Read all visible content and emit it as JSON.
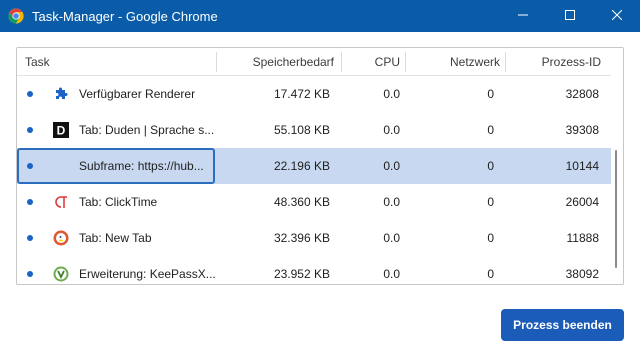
{
  "window": {
    "title": "Task-Manager - Google Chrome",
    "controls": [
      "minimize-icon",
      "maximize-icon",
      "close-icon"
    ]
  },
  "colors": {
    "titlebar": "#0b5ca8",
    "selection": "#c8d8f0",
    "accent": "#1a5cb8",
    "status_dot": "#1a63c9"
  },
  "table": {
    "columns": [
      "Task",
      "Speicherbedarf",
      "CPU",
      "Netzwerk",
      "Prozess-ID"
    ],
    "rows": [
      {
        "icon": "puzzle-icon",
        "task": "Verfügbarer Renderer",
        "memory": "17.472 KB",
        "cpu": "0.0",
        "network": "0",
        "pid": "32808",
        "selected": false
      },
      {
        "icon": "duden-icon",
        "task": "Tab: Duden | Sprache s...",
        "memory": "55.108 KB",
        "cpu": "0.0",
        "network": "0",
        "pid": "39308",
        "selected": false
      },
      {
        "icon": "none",
        "task": "Subframe: https://hub...",
        "memory": "22.196 KB",
        "cpu": "0.0",
        "network": "0",
        "pid": "10144",
        "selected": true
      },
      {
        "icon": "clicktime-icon",
        "task": "Tab: ClickTime",
        "memory": "48.360 KB",
        "cpu": "0.0",
        "network": "0",
        "pid": "26004",
        "selected": false
      },
      {
        "icon": "duckduckgo-icon",
        "task": "Tab: New Tab",
        "memory": "32.396 KB",
        "cpu": "0.0",
        "network": "0",
        "pid": "11888",
        "selected": false
      },
      {
        "icon": "keepassxc-icon",
        "task": "Erweiterung: KeePassX...",
        "memory": "23.952 KB",
        "cpu": "0.0",
        "network": "0",
        "pid": "38092",
        "selected": false
      }
    ]
  },
  "actions": {
    "end_process": "Prozess beenden"
  }
}
